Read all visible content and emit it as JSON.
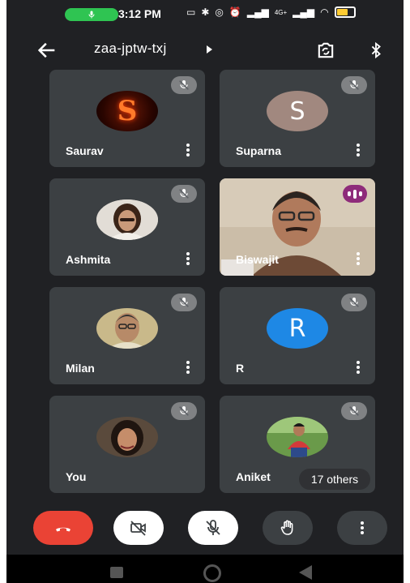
{
  "status_bar": {
    "time": "3:12 PM",
    "network_label_1": "4G+",
    "battery_level": 0.7
  },
  "header": {
    "title": "zaa-jptw-txj"
  },
  "participants": [
    {
      "name": "Saurav",
      "avatar_letter": "S",
      "muted": true
    },
    {
      "name": "Suparna",
      "avatar_letter": "S",
      "muted": true
    },
    {
      "name": "Ashmita",
      "muted": true
    },
    {
      "name": "Biswajit",
      "speaking": true
    },
    {
      "name": "Milan",
      "muted": true
    },
    {
      "name": "R",
      "avatar_letter": "R",
      "muted": true
    },
    {
      "name": "You",
      "muted": true
    },
    {
      "name": "Aniket",
      "muted": true
    }
  ],
  "others_count_label": "17 others",
  "controls": [
    "end-call",
    "camera-off",
    "mic-off",
    "raise-hand",
    "more-options"
  ],
  "colors": {
    "background": "#202124",
    "tile": "#3c4043",
    "end_call": "#ea4335",
    "suparna_avatar": "#a1887f",
    "r_avatar": "#1e88e5",
    "speaking_badge": "#8e2b7a",
    "call_pill": "#2fc452"
  }
}
